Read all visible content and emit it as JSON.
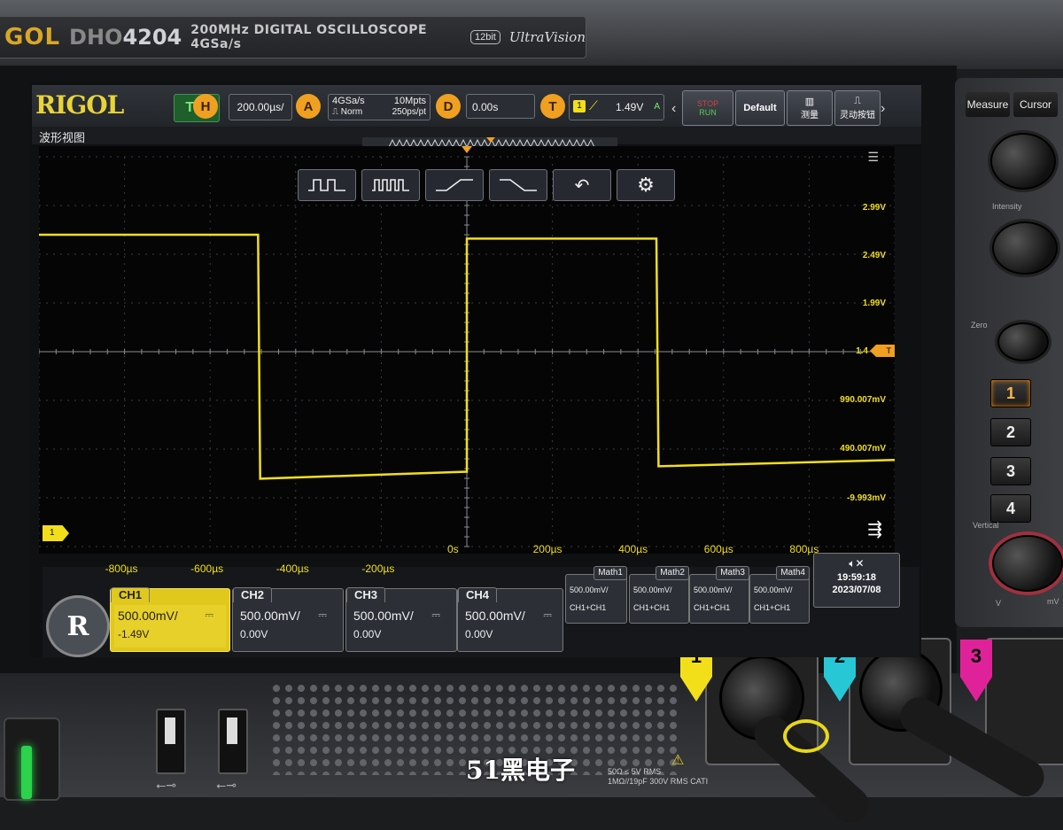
{
  "nameplate": {
    "brand": "GOL",
    "model_prefix": "DHO",
    "model_number": "4204",
    "description": "200MHz DIGITAL OSCILLOSCOPE 4GSa/s",
    "bits": "12bit",
    "ultravision": "UltraVision"
  },
  "topbar": {
    "logo": "RIGOL",
    "mode": "T'D",
    "horizontal": {
      "icon": "H",
      "value": "200.00µs/"
    },
    "acquire": {
      "icon": "A",
      "sample_rate": "4GSa/s",
      "mode": "Norm",
      "depth": "10Mpts",
      "resolution": "250ps/pt"
    },
    "delay": {
      "icon": "D",
      "value": "0.00s"
    },
    "trigger": {
      "icon": "T",
      "source": "1",
      "level": "1.49V",
      "mode": "A"
    },
    "quick_buttons": {
      "stop": "STOP",
      "run": "RUN",
      "default": "Default",
      "measure": "测量",
      "smart": "灵动按钮"
    }
  },
  "waveform_view": {
    "title": "波形视图"
  },
  "toolbar_icons": [
    "pulse-trigger-icon",
    "multi-pulse-icon",
    "rising-edge-icon",
    "falling-edge-icon",
    "undo-icon",
    "settings-icon"
  ],
  "chart_data": {
    "type": "line",
    "x_unit": "µs",
    "y_unit": "V",
    "xlim": [
      -1000,
      1000
    ],
    "ylim": [
      -1.01,
      3.99
    ],
    "x_ticks": [
      "-800µs",
      "-600µs",
      "-400µs",
      "-200µs",
      "0s",
      "200µs",
      "400µs",
      "600µs",
      "800µs"
    ],
    "y_ticks": [
      "2.99V",
      "2.49V",
      "1.99V",
      "1.4",
      "990.007mV",
      "490.007mV",
      "-9.993mV"
    ],
    "series": [
      {
        "x": [
          -1000,
          -488,
          -483,
          0,
          0,
          443,
          448,
          1000
        ],
        "y": [
          2.99,
          2.99,
          -0.14,
          -0.05,
          2.94,
          2.94,
          0.02,
          0.1
        ],
        "color": "#f2df1a"
      }
    ],
    "trigger_level": 1.49,
    "grid": true
  },
  "markers": {
    "ch1": "1",
    "trigger": "T"
  },
  "channels": [
    {
      "tag": "CH1",
      "scale": "500.00mV/",
      "offset": "-1.49V",
      "active": true
    },
    {
      "tag": "CH2",
      "scale": "500.00mV/",
      "offset": "0.00V",
      "active": false
    },
    {
      "tag": "CH3",
      "scale": "500.00mV/",
      "offset": "0.00V",
      "active": false
    },
    {
      "tag": "CH4",
      "scale": "500.00mV/",
      "offset": "0.00V",
      "active": false
    }
  ],
  "math": [
    {
      "tag": "Math1",
      "scale": "500.00mV/",
      "expr": "CH1+CH1"
    },
    {
      "tag": "Math2",
      "scale": "500.00mV/",
      "expr": "CH1+CH1"
    },
    {
      "tag": "Math3",
      "scale": "500.00mV/",
      "expr": "CH1+CH1"
    },
    {
      "tag": "Math4",
      "scale": "500.00mV/",
      "expr": "CH1+CH1"
    }
  ],
  "status": {
    "time": "19:59:18",
    "date": "2023/07/08"
  },
  "panel": {
    "measure": "Measure",
    "cursor": "Cursor",
    "intensity": "Intensity",
    "zero": "Zero",
    "vertical": "Vertical",
    "mv": "mV",
    "v": "V",
    "keys": [
      "1",
      "2",
      "3",
      "4"
    ],
    "input_spec_1": "50Ω ≤ 5V RMS",
    "input_spec_2": "1MΩ//19pF 300V RMS CATI",
    "inputs": [
      "1",
      "2",
      "3"
    ]
  },
  "watermark": "51黑电子",
  "colors": {
    "ch1": "#f2df1a",
    "trigger": "#f0a020",
    "ch2": "#27c7d6",
    "ch3": "#e0229a"
  }
}
